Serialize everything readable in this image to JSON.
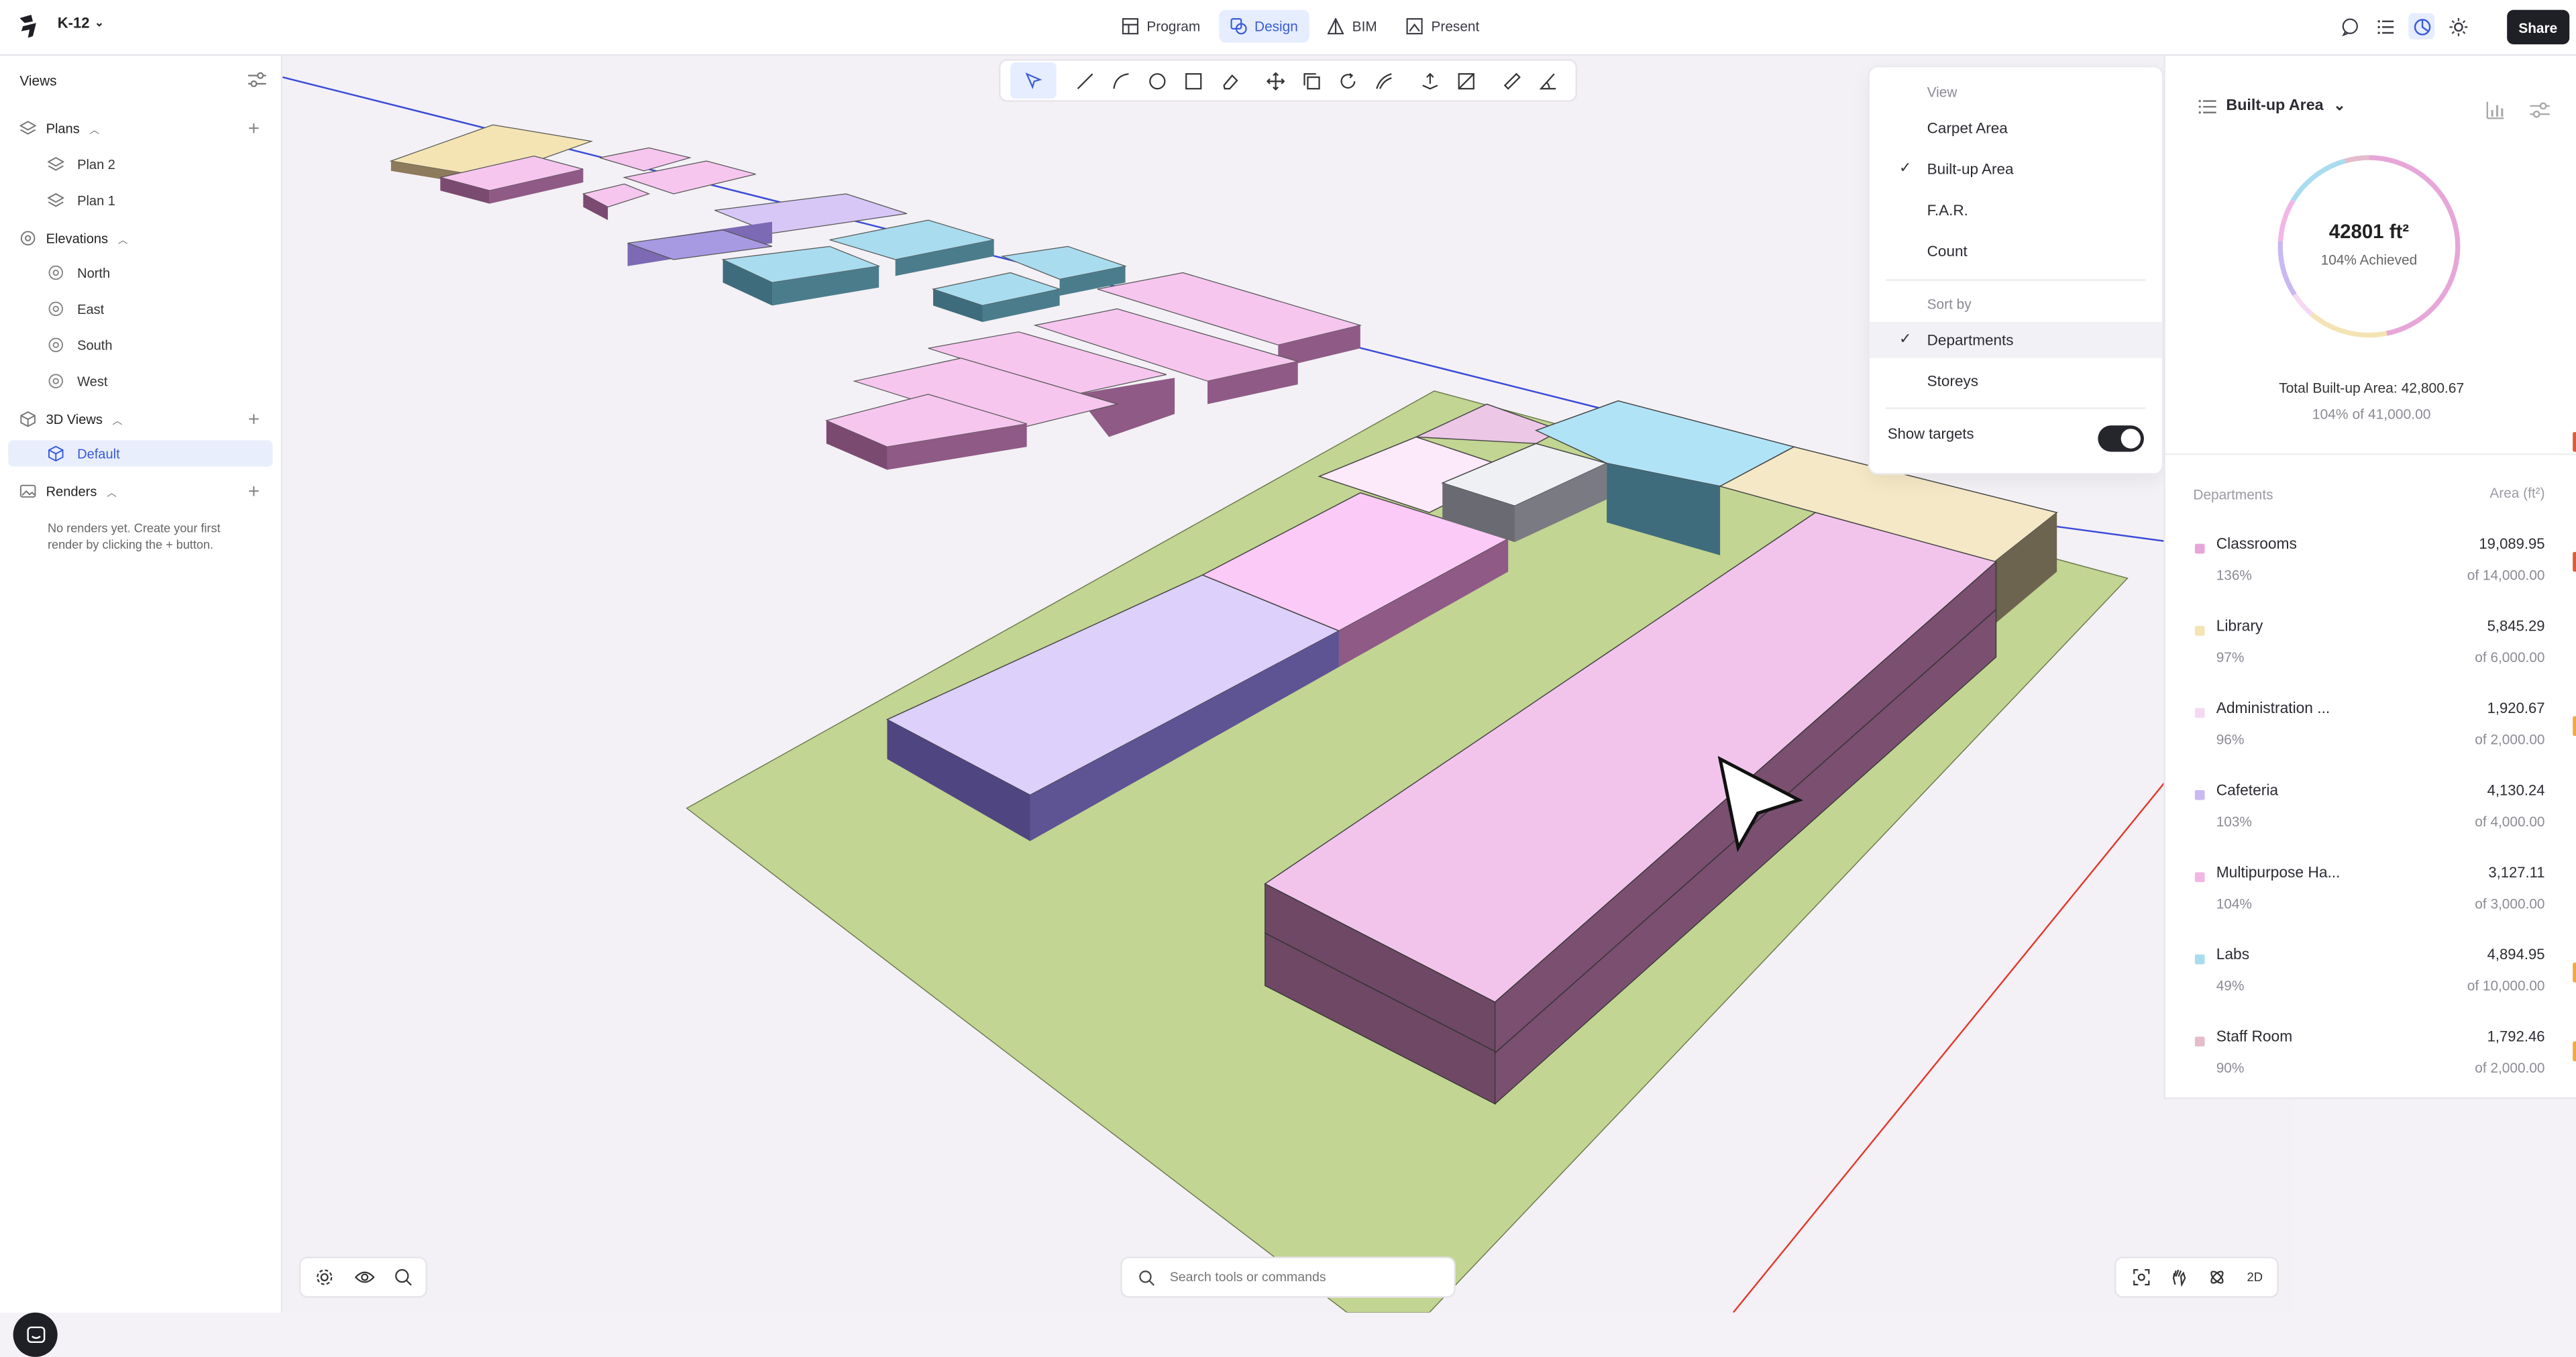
{
  "app": {
    "project": "K-12",
    "modes": [
      {
        "label": "Program",
        "icon": "table-icon"
      },
      {
        "label": "Design",
        "icon": "shapes-icon",
        "active": true
      },
      {
        "label": "BIM",
        "icon": "bim-icon"
      },
      {
        "label": "Present",
        "icon": "present-icon"
      }
    ],
    "share_label": "Share"
  },
  "sidebar": {
    "title": "Views",
    "plans_label": "Plans",
    "plans": [
      "Plan 2",
      "Plan 1"
    ],
    "elevations_label": "Elevations",
    "elevations": [
      "North",
      "East",
      "South",
      "West"
    ],
    "views3d_label": "3D Views",
    "views3d": [
      "Default"
    ],
    "renders_label": "Renders",
    "renders_note": "No renders yet. Create your first render by clicking the + button."
  },
  "toolbar": {
    "tools": [
      "select-tool-icon",
      "line-tool-icon",
      "arc-tool-icon",
      "circle-tool-icon",
      "rectangle-tool-icon",
      "eraser-tool-icon",
      "move-tool-icon",
      "copy-tool-icon",
      "rotate-tool-icon",
      "offset-tool-icon",
      "pushpull-tool-icon",
      "mirror-tool-icon",
      "measure-tool-icon",
      "angle-tool-icon"
    ]
  },
  "search": {
    "placeholder": "Search tools or commands"
  },
  "view_buttons_right": {
    "mode_2d": "2D"
  },
  "menu": {
    "view_label": "View",
    "view_options": [
      "Carpet Area",
      "Built-up Area",
      "F.A.R.",
      "Count"
    ],
    "view_selected": "Built-up Area",
    "sort_label": "Sort by",
    "sort_options": [
      "Departments",
      "Storeys"
    ],
    "sort_selected": "Departments",
    "show_targets_label": "Show targets",
    "show_targets": true
  },
  "panel": {
    "metric": "Built-up Area",
    "donut_value": "42801 ft²",
    "donut_sub": "104% Achieved",
    "achieved_fraction": 1.04,
    "total": "Total Built-up Area: 42,800.67",
    "total_sub": "104% of 41,000.00",
    "col_left": "Departments",
    "col_right": "Area (ft²)",
    "departments": [
      {
        "name": "Classrooms",
        "value": "19,089.95",
        "pct": "136%",
        "target": "of 14,000.00",
        "color": "#e7a6d8"
      },
      {
        "name": "Library",
        "value": "5,845.29",
        "pct": "97%",
        "target": "of 6,000.00",
        "color": "#f4e4b4"
      },
      {
        "name": "Administration ...",
        "value": "1,920.67",
        "pct": "96%",
        "target": "of 2,000.00",
        "color": "#f5d9f2"
      },
      {
        "name": "Cafeteria",
        "value": "4,130.24",
        "pct": "103%",
        "target": "of 4,000.00",
        "color": "#c9b8f2"
      },
      {
        "name": "Multipurpose Ha...",
        "value": "3,127.11",
        "pct": "104%",
        "target": "of 3,000.00",
        "color": "#f2b6e6"
      },
      {
        "name": "Labs",
        "value": "4,894.95",
        "pct": "49%",
        "target": "of 10,000.00",
        "color": "#a9dcee"
      },
      {
        "name": "Staff Room",
        "value": "1,792.46",
        "pct": "90%",
        "target": "of 2,000.00",
        "color": "#e4bccb"
      }
    ]
  }
}
